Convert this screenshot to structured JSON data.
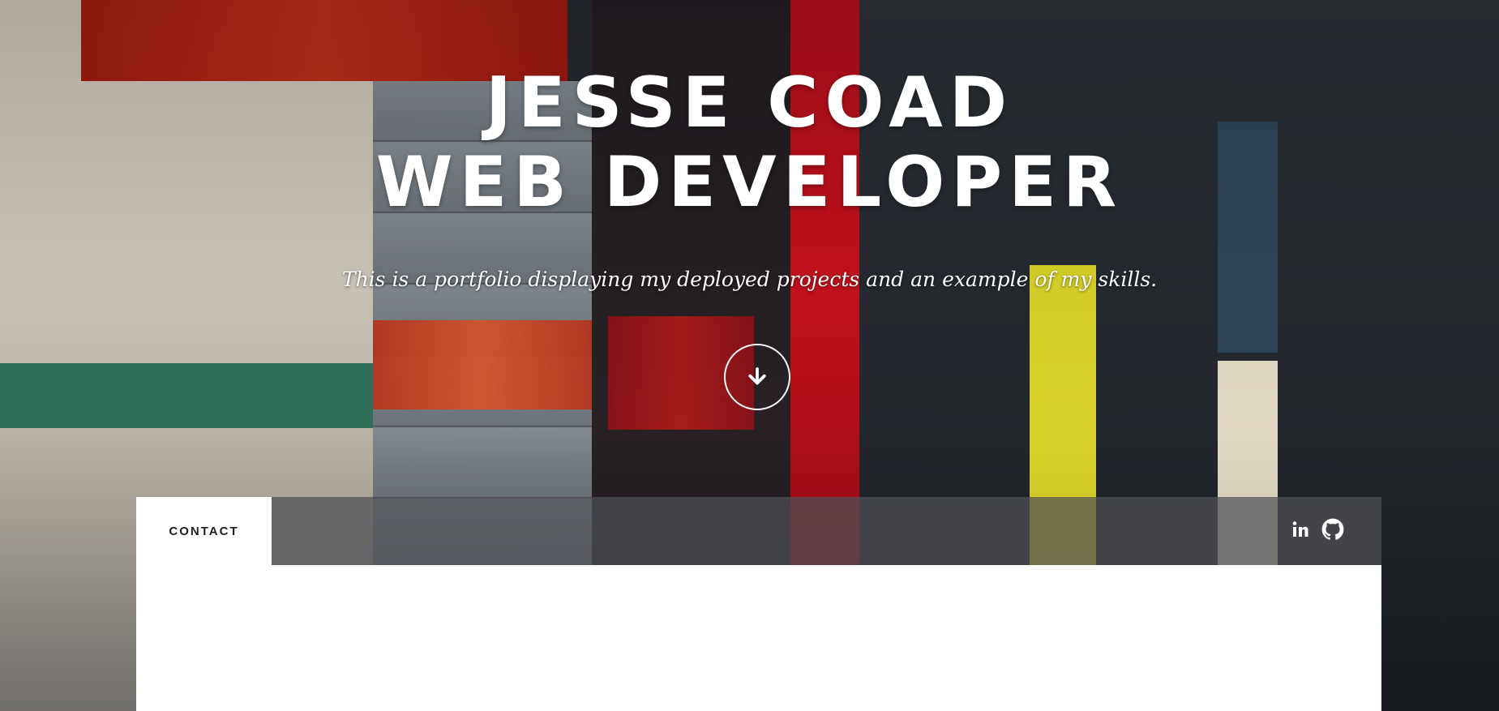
{
  "hero": {
    "title_line1": "JESSE COAD",
    "title_line2": "WEB DEVELOPER",
    "subtitle": "This is a portfolio displaying my deployed projects and an example of my skills.",
    "scroll_icon": "arrow-down-circle-icon"
  },
  "nav": {
    "contact_label": "CONTACT",
    "social": [
      {
        "icon": "linkedin-icon",
        "label": "in"
      },
      {
        "icon": "github-icon"
      }
    ]
  },
  "colors": {
    "text": "#ffffff",
    "nav_bar": "#505258",
    "panel": "#ffffff"
  }
}
